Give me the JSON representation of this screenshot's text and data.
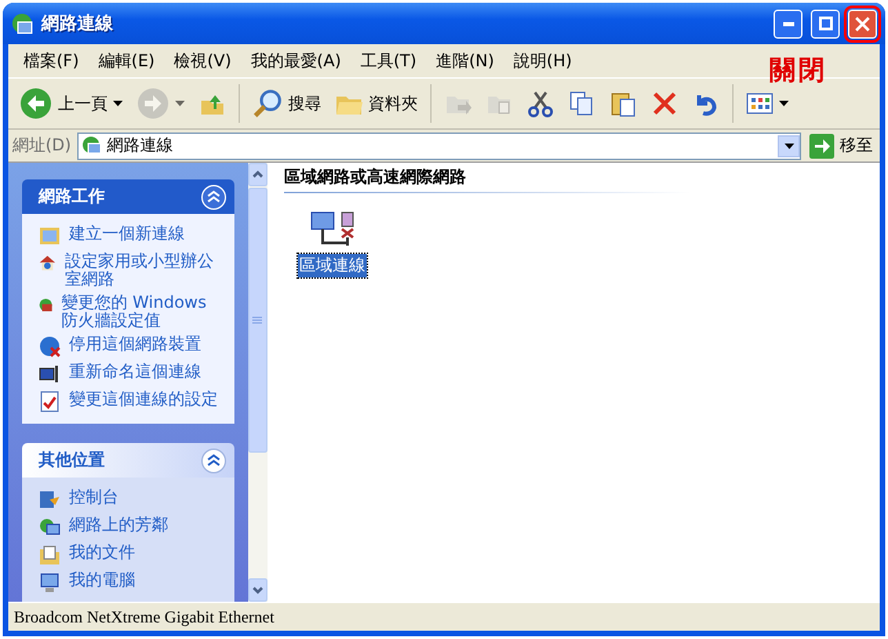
{
  "window": {
    "title": "網路連線"
  },
  "annotation": {
    "text": "關閉"
  },
  "menu": [
    "檔案(F)",
    "編輯(E)",
    "檢視(V)",
    "我的最愛(A)",
    "工具(T)",
    "進階(N)",
    "說明(H)"
  ],
  "toolbar": [
    {
      "kind": "back",
      "label": "上一頁",
      "disabled": false
    },
    {
      "kind": "forward",
      "disabled": true
    },
    {
      "kind": "up",
      "disabled": false
    },
    {
      "kind": "search",
      "label": "搜尋",
      "disabled": false
    },
    {
      "kind": "folders",
      "label": "資料夾",
      "disabled": false
    },
    {
      "kind": "moveto",
      "disabled": true
    },
    {
      "kind": "copyto",
      "disabled": true
    },
    {
      "kind": "cut",
      "disabled": false
    },
    {
      "kind": "copy",
      "disabled": false
    },
    {
      "kind": "paste",
      "disabled": false
    },
    {
      "kind": "delete",
      "disabled": false
    },
    {
      "kind": "undo",
      "disabled": false
    },
    {
      "kind": "views",
      "disabled": false
    }
  ],
  "address": {
    "label": "網址(D)",
    "value": "網路連線",
    "go": "移至"
  },
  "sidebar": {
    "panels": [
      {
        "title": "網路工作",
        "expanded": true,
        "items": [
          "建立一個新連線",
          "設定家用或小型辦公室網路",
          "變更您的 Windows 防火牆設定值",
          "停用這個網路裝置",
          "重新命名這個連線",
          "變更這個連線的設定"
        ]
      },
      {
        "title": "其他位置",
        "expanded": true,
        "items": [
          "控制台",
          "網路上的芳鄰",
          "我的文件",
          "我的電腦"
        ]
      }
    ]
  },
  "content": {
    "group": "區域網路或高速網際網路",
    "items": [
      {
        "label": "區域連線",
        "selected": true
      }
    ]
  },
  "status_bar": "Broadcom NetXtreme Gigabit Ethernet"
}
